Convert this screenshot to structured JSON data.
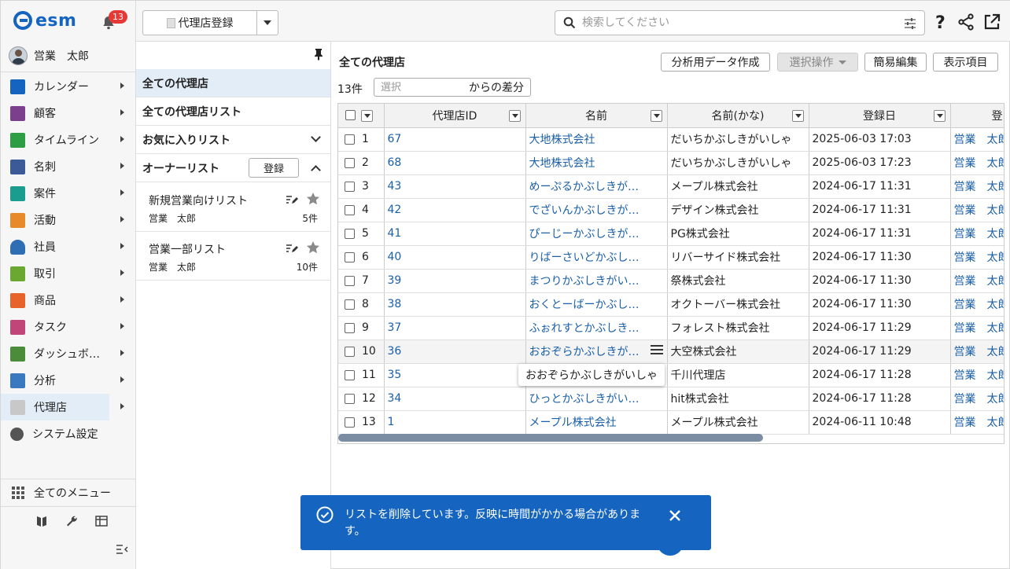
{
  "app": {
    "logo_text": "esm",
    "notification_count": "13"
  },
  "user": {
    "name": "営業　太郎"
  },
  "sidebar": {
    "items": [
      {
        "label": "カレンダー",
        "icon": "calendar-icon",
        "color": "#1565c0"
      },
      {
        "label": "顧客",
        "icon": "building-icon",
        "color": "#7b3f8e"
      },
      {
        "label": "タイムライン",
        "icon": "chat-icon",
        "color": "#2e9e44"
      },
      {
        "label": "名刺",
        "icon": "card-icon",
        "color": "#3d5a98"
      },
      {
        "label": "案件",
        "icon": "folder-icon",
        "color": "#1a9c8e"
      },
      {
        "label": "活動",
        "icon": "clipboard-icon",
        "color": "#e8892b"
      },
      {
        "label": "社員",
        "icon": "person-icon",
        "color": "#2f6db5"
      },
      {
        "label": "取引",
        "icon": "ledger-icon",
        "color": "#6aa832"
      },
      {
        "label": "商品",
        "icon": "box-icon",
        "color": "#e8622b"
      },
      {
        "label": "タスク",
        "icon": "task-icon",
        "color": "#c2457a"
      },
      {
        "label": "ダッシュボ…",
        "icon": "dashboard-icon",
        "color": "#4a8c3a"
      },
      {
        "label": "分析",
        "icon": "bar-chart-icon",
        "color": "#3a78c0"
      },
      {
        "label": "代理店",
        "icon": "document-icon",
        "color": "#c8c8c8"
      },
      {
        "label": "システム設定",
        "icon": "gear-icon",
        "color": "#555555"
      }
    ],
    "all_menu_label": "全てのメニュー"
  },
  "topbar": {
    "register_label": "代理店登録",
    "search_placeholder": "検索してください"
  },
  "listpanel": {
    "rows": [
      {
        "label": "全ての代理店"
      },
      {
        "label": "全ての代理店リスト"
      },
      {
        "label": "お気に入りリスト"
      },
      {
        "label": "オーナーリスト"
      }
    ],
    "register_label": "登録",
    "owner_lists": [
      {
        "name": "新規営業向けリスト",
        "owner": "営業　太郎",
        "count": "5件"
      },
      {
        "name": "営業一部リスト",
        "owner": "営業　太郎",
        "count": "10件"
      }
    ]
  },
  "main": {
    "title": "全ての代理店",
    "buttons": {
      "analysis": "分析用データ作成",
      "select_ops": "選択操作",
      "quick_edit": "簡易編集",
      "display": "表示項目"
    },
    "count": "13件",
    "diff_placeholder": "選択",
    "diff_suffix": "からの差分",
    "columns": [
      "代理店ID",
      "名前",
      "名前(かな)",
      "登録日",
      "登"
    ],
    "rows": [
      {
        "n": "1",
        "id": "67",
        "name": "大地株式会社",
        "kana": "だいちかぶしきがいしゃ",
        "date": "2025-06-03 17:03",
        "owner": "営業　太郎"
      },
      {
        "n": "2",
        "id": "68",
        "name": "大地株式会社",
        "kana": "だいちかぶしきがいしゃ",
        "date": "2025-06-03 17:23",
        "owner": "営業　太郎"
      },
      {
        "n": "3",
        "id": "43",
        "name": "めーぷるかぶしきが…",
        "kana": "メープル株式会社",
        "date": "2024-06-17 11:31",
        "owner": "営業　太郎"
      },
      {
        "n": "4",
        "id": "42",
        "name": "でざいんかぶしきが…",
        "kana": "デザイン株式会社",
        "date": "2024-06-17 11:31",
        "owner": "営業　太郎"
      },
      {
        "n": "5",
        "id": "41",
        "name": "ぴーじーかぶしきが…",
        "kana": "PG株式会社",
        "date": "2024-06-17 11:31",
        "owner": "営業　太郎"
      },
      {
        "n": "6",
        "id": "40",
        "name": "りばーさいどかぶし…",
        "kana": "リバーサイド株式会社",
        "date": "2024-06-17 11:30",
        "owner": "営業　太郎"
      },
      {
        "n": "7",
        "id": "39",
        "name": "まつりかぶしきがい…",
        "kana": "祭株式会社",
        "date": "2024-06-17 11:30",
        "owner": "営業　太郎"
      },
      {
        "n": "8",
        "id": "38",
        "name": "おくとーばーかぶし…",
        "kana": "オクトーバー株式会社",
        "date": "2024-06-17 11:30",
        "owner": "営業　太郎"
      },
      {
        "n": "9",
        "id": "37",
        "name": "ふぉれすとかぶしき…",
        "kana": "フォレスト株式会社",
        "date": "2024-06-17 11:29",
        "owner": "営業　太郎"
      },
      {
        "n": "10",
        "id": "36",
        "name": "おおぞらかぶしきが…",
        "kana": "大空株式会社",
        "date": "2024-06-17 11:29",
        "owner": "営業　太郎"
      },
      {
        "n": "11",
        "id": "35",
        "name": "",
        "kana": "千川代理店",
        "date": "2024-06-17 11:28",
        "owner": "営業　太郎"
      },
      {
        "n": "12",
        "id": "34",
        "name": "ひっとかぶしきがい…",
        "kana": "hit株式会社",
        "date": "2024-06-17 11:28",
        "owner": "営業　太郎"
      },
      {
        "n": "13",
        "id": "1",
        "name": "メープル株式会社",
        "kana": "メープル株式会社",
        "date": "2024-06-11 10:48",
        "owner": "営業　太郎"
      }
    ],
    "tooltip": "おおぞらかぶしきがいしゃ"
  },
  "toast": {
    "message": "リストを削除しています。反映に時間がかかる場合があります。"
  },
  "colors": {
    "accent": "#1565c0",
    "link": "#1a5fa8",
    "selected_bg": "#e3edf7"
  }
}
